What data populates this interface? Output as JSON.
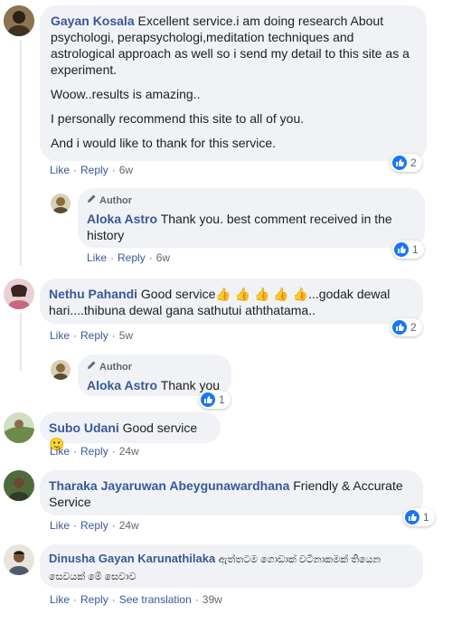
{
  "comments": [
    {
      "name": "Gayan Kosala",
      "paragraphs": [
        "Excellent service.i am doing research About psychologi, perapsychologi,meditation techniques and astrological approach as well so i send my detail to this site as a experiment.",
        "Woow..results is amazing..",
        "I personally recommend this site to all of you.",
        "And i would like to thank for this service."
      ],
      "like_label": "Like",
      "reply_label": "Reply",
      "time": "6w",
      "reaction_count": "2"
    },
    {
      "name": "Aloka Astro",
      "author_badge": "Author",
      "text": "Thank you. best comment received in the history",
      "like_label": "Like",
      "reply_label": "Reply",
      "time": "6w",
      "reaction_count": "1"
    },
    {
      "name": "Nethu Pahandi",
      "text_start": "Good service",
      "emoji": "👍 👍 👍 👍 👍",
      "text_end": "...godak dewal hari....thibuna dewal gana sathutui aththatama..",
      "like_label": "Like",
      "reply_label": "Reply",
      "time": "5w",
      "reaction_count": "2"
    },
    {
      "name": "Aloka Astro",
      "author_badge": "Author",
      "text": "Thank you",
      "reaction_count": "1"
    },
    {
      "name": "Subo Udani",
      "text": "Good service",
      "emoji": "🙂",
      "like_label": "Like",
      "reply_label": "Reply",
      "time": "24w"
    },
    {
      "name": "Tharaka Jayaruwan Abeygunawardhana",
      "text": "Friendly & Accurate Service",
      "like_label": "Like",
      "reply_label": "Reply",
      "time": "24w",
      "reaction_count": "1"
    },
    {
      "name": "Dinusha Gayan Karunathilaka",
      "text": "ඇත්තටම ගොඩාක් වටිනාකමක් තියෙන සෙවයක් මේ සෙවාව",
      "like_label": "Like",
      "reply_label": "Reply",
      "translate_label": "See translation",
      "time": "39w"
    }
  ],
  "colors": {
    "name": "#385898",
    "bubble": "#f0f2f5",
    "like_blue": "#1877f2",
    "meta_gray": "#606770"
  },
  "icons": {
    "author_badge": "pencil-icon",
    "reaction": "thumbs-up-icon"
  }
}
